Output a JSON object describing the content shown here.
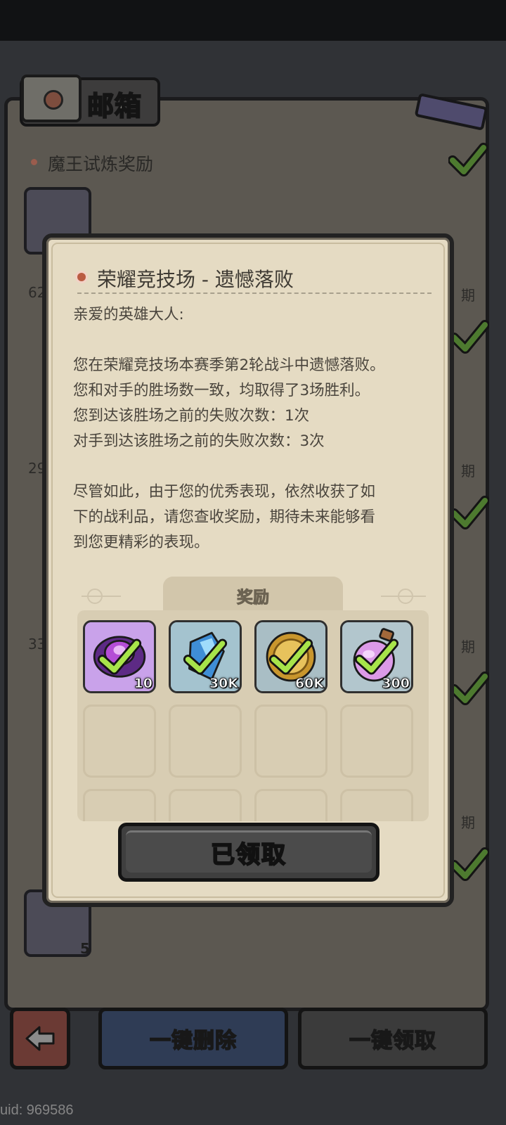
{
  "mailbox": {
    "title": "邮箱",
    "first_mail_title": "魔王试炼奖励",
    "side_texts": [
      "62",
      "29",
      "33",
      "期",
      "期",
      "期",
      "期"
    ],
    "bottom_item_qty": "5"
  },
  "bottom_bar": {
    "back_label": "",
    "delete_all_label": "一键删除",
    "claim_all_label": "一键领取"
  },
  "uid": "uid: 969586",
  "mail_detail": {
    "title": "荣耀竞技场 - 遗憾落败",
    "greeting": "亲爱的英雄大人:",
    "para1": [
      "您在荣耀竞技场本赛季第2轮战斗中遗憾落败。",
      "您和对手的胜场数一致，均取得了3场胜利。",
      "您到达该胜场之前的失败次数：1次",
      "对手到达该胜场之前的失败次数：3次"
    ],
    "para2": [
      "尽管如此，由于您的优秀表现，依然收获了如",
      "下的战利品，请您查收奖励，期待未来能够看",
      "到您更精彩的表现。"
    ],
    "rewards_label": "奖励",
    "rewards": [
      {
        "icon": "purple-orb-icon",
        "qty": "10",
        "color": "#b98ad9"
      },
      {
        "icon": "blue-crystal-icon",
        "qty": "30K",
        "color": "#8fb7c8"
      },
      {
        "icon": "gold-coin-icon",
        "qty": "60K",
        "color": "#9fb5bd"
      },
      {
        "icon": "pink-potion-icon",
        "qty": "300",
        "color": "#a7bcc4"
      }
    ],
    "claimed_label": "已领取"
  }
}
